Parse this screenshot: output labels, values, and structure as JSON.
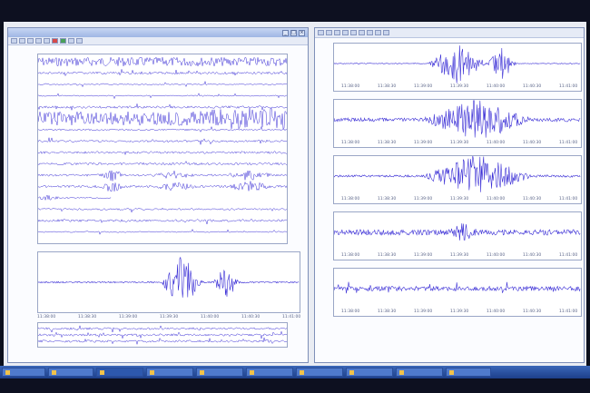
{
  "left_window": {
    "title": "",
    "toolbar_text": "",
    "heli_rows": 16,
    "bottom_axis_labels": [
      "11:38:00",
      "11:38:30",
      "11:39:00",
      "11:39:30",
      "11:40:00",
      "11:40:30",
      "11:41:00"
    ],
    "status_text": ""
  },
  "right_window": {
    "traces": [
      {
        "time_labels": [
          "11:38:00",
          "11:38:30",
          "11:39:00",
          "11:39:30",
          "11:40:00",
          "11:40:30",
          "11:41:00"
        ]
      },
      {
        "time_labels": [
          "11:38:00",
          "11:38:30",
          "11:39:00",
          "11:39:30",
          "11:40:00",
          "11:40:30",
          "11:41:00"
        ]
      },
      {
        "time_labels": [
          "11:38:00",
          "11:38:30",
          "11:39:00",
          "11:39:30",
          "11:40:00",
          "11:40:30",
          "11:41:00"
        ]
      },
      {
        "time_labels": [
          "11:38:00",
          "11:38:30",
          "11:39:00",
          "11:39:30",
          "11:40:00",
          "11:40:30",
          "11:41:00"
        ]
      },
      {
        "time_labels": [
          "11:38:00",
          "11:38:30",
          "11:39:00",
          "11:39:30",
          "11:40:00",
          "11:40:30",
          "11:41:00"
        ]
      }
    ]
  },
  "taskbar": {
    "items": [
      "",
      "",
      "",
      "",
      "",
      "",
      "",
      "",
      "",
      ""
    ]
  },
  "colors": {
    "trace": "#3b2fd6",
    "window_border": "#7e8fb8",
    "taskbar": "#2a56ad"
  }
}
